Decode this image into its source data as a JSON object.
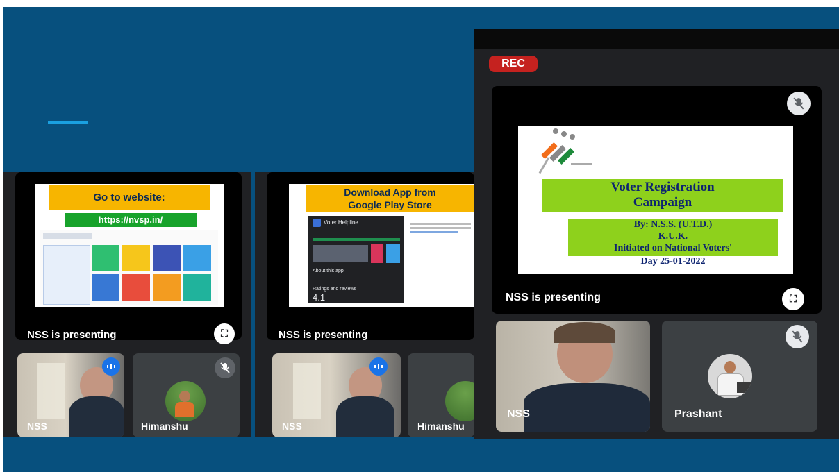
{
  "colors": {
    "slide_bg": "#07507e",
    "accent": "#1aa0e0",
    "meet_bg": "#202124",
    "rec": "#c5221f"
  },
  "screen1": {
    "slide_banner": "Go to website:",
    "slide_url": "https://nvsp.in/",
    "presenting_label": "NSS is presenting",
    "participants": [
      {
        "name": "NSS",
        "icon": "speaking-icon"
      },
      {
        "name": "Himanshu",
        "icon": "mic-off-icon"
      }
    ]
  },
  "screen2": {
    "slide_banner_line1": "Download App from",
    "slide_banner_line2": "Google Play Store",
    "app_name": "Voter Helpline",
    "about_label": "About this app",
    "ratings_label": "Ratings and reviews",
    "rating": "4.1",
    "presenting_label": "NSS is presenting",
    "participants": [
      {
        "name": "NSS",
        "icon": "speaking-icon"
      },
      {
        "name": "Himanshu",
        "icon": "mic-off-icon"
      }
    ]
  },
  "screen3": {
    "rec_label": "REC",
    "slide_title_line1": "Voter Registration",
    "slide_title_line2": "Campaign",
    "slide_by": "By: N.S.S. (U.T.D.)",
    "slide_org": "K.U.K.",
    "slide_initiated": "Initiated on National Voters'",
    "slide_day": "Day 25-01-2022",
    "presenting_label": "NSS is presenting",
    "participants": [
      {
        "name": "NSS",
        "icon": "none"
      },
      {
        "name": "Prashant",
        "icon": "mic-off-icon"
      }
    ]
  }
}
